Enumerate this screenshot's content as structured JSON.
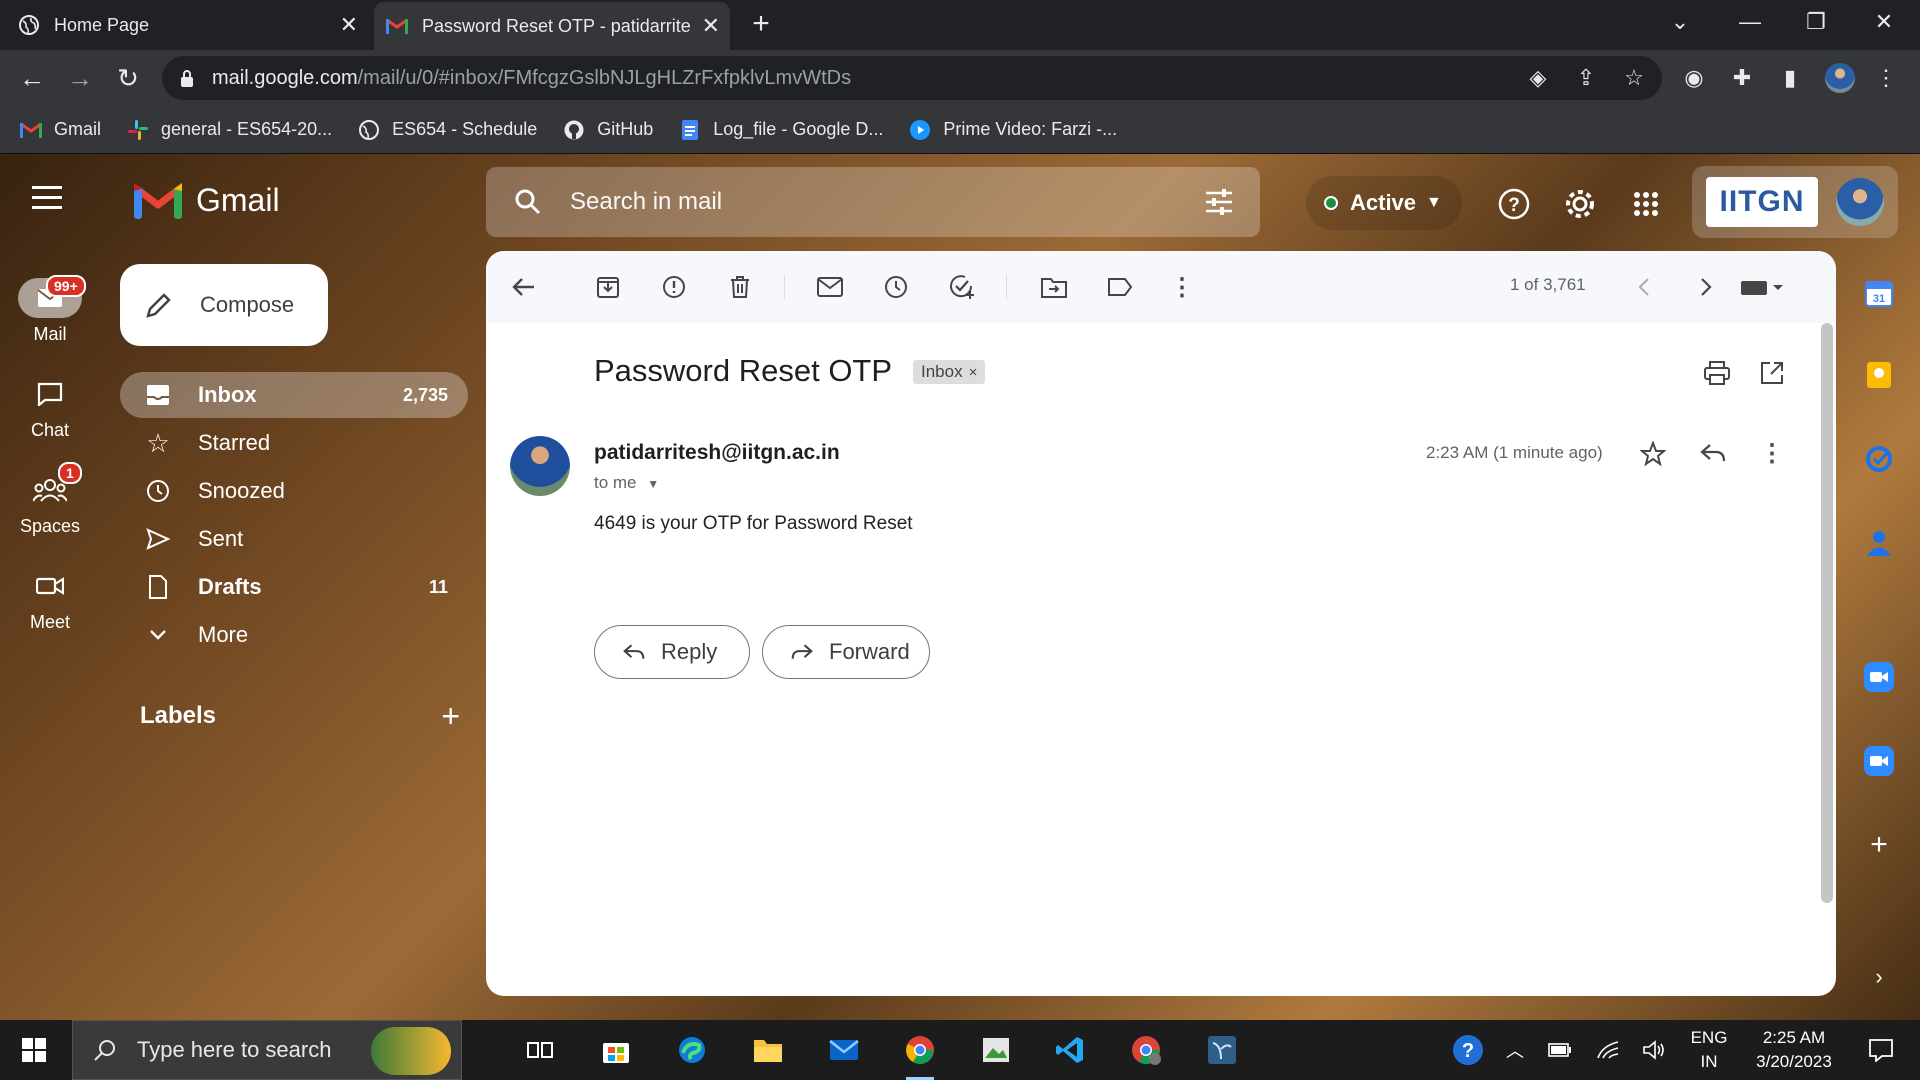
{
  "browser": {
    "tabs": [
      {
        "title": "Home Page",
        "active": false
      },
      {
        "title": "Password Reset OTP - patidarrite",
        "active": true
      }
    ],
    "new_tab": "+",
    "url_host": "mail.google.com",
    "url_path": "/mail/u/0/#inbox/FMfcgzGslbNJLgHLZrFxfpklvLmvWtDs",
    "bookmarks": [
      {
        "label": "Gmail",
        "icon": "gmail-icon"
      },
      {
        "label": "general - ES654-20...",
        "icon": "slack-icon"
      },
      {
        "label": "ES654 - Schedule",
        "icon": "globe-icon"
      },
      {
        "label": "GitHub",
        "icon": "github-icon"
      },
      {
        "label": "Log_file - Google D...",
        "icon": "docs-icon"
      },
      {
        "label": "Prime Video: Farzi -...",
        "icon": "prime-icon"
      }
    ]
  },
  "gmail": {
    "brand": "Gmail",
    "search_placeholder": "Search in mail",
    "status": "Active",
    "account_brand": "IITGN",
    "rail": [
      {
        "label": "Mail",
        "badge": "99+"
      },
      {
        "label": "Chat",
        "badge": ""
      },
      {
        "label": "Spaces",
        "badge": "1"
      },
      {
        "label": "Meet",
        "badge": ""
      }
    ],
    "compose": "Compose",
    "nav": [
      {
        "label": "Inbox",
        "count": "2,735"
      },
      {
        "label": "Starred",
        "count": ""
      },
      {
        "label": "Snoozed",
        "count": ""
      },
      {
        "label": "Sent",
        "count": ""
      },
      {
        "label": "Drafts",
        "count": "11"
      },
      {
        "label": "More",
        "count": ""
      }
    ],
    "labels_heading": "Labels",
    "labels_add": "+"
  },
  "message": {
    "pager": "1 of 3,761",
    "subject": "Password Reset OTP",
    "tag": "Inbox",
    "tag_remove": "×",
    "sender": "patidarritesh@iitgn.ac.in",
    "to": "to me",
    "time": "2:23 AM (1 minute ago)",
    "body": "4649 is your OTP for Password Reset",
    "reply": "Reply",
    "forward": "Forward"
  },
  "taskbar": {
    "search_placeholder": "Type here to search",
    "lang_top": "ENG",
    "lang_bottom": "IN",
    "time": "2:25 AM",
    "date": "3/20/2023"
  },
  "colors": {
    "gmail_red": "#ea4335",
    "active_green": "#1e8e3e",
    "badge_red": "#d93025"
  }
}
